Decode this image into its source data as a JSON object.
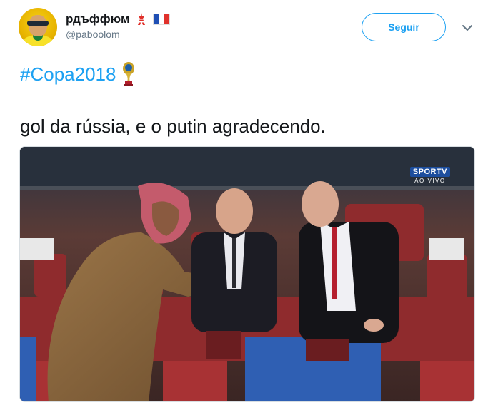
{
  "user": {
    "display_name": "рдъффюм",
    "handle": "@paboolom",
    "avatar": "avatar",
    "emoji_icons": [
      "tokyo-tower-icon",
      "france-flag-icon"
    ]
  },
  "actions": {
    "follow_label": "Seguir",
    "menu_icon": "chevron-down-icon"
  },
  "tweet": {
    "hashtag": "#Copa2018",
    "hashtag_icon": "world-cup-trophy-icon",
    "text": "gol da rússia, e o putin agradecendo."
  },
  "media": {
    "broadcast_logo": "SPORTV",
    "broadcast_status": "AO VIVO"
  },
  "colors": {
    "link": "#1da1f2",
    "text": "#14171a",
    "secondary": "#657786",
    "broadcast_blue": "#1d4e9e"
  }
}
